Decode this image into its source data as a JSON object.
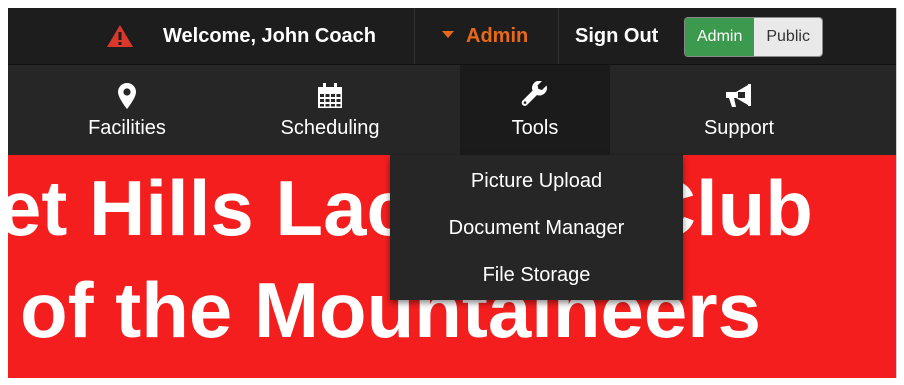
{
  "topbar": {
    "welcome_text": "Welcome, John Coach",
    "admin_menu_label": "Admin",
    "signout_label": "Sign Out",
    "view_toggle": {
      "active_label": "Admin",
      "inactive_label": "Public"
    }
  },
  "nav": {
    "items": [
      {
        "label": "Facilities",
        "icon": "map-marker-icon"
      },
      {
        "label": "Scheduling",
        "icon": "calendar-icon"
      },
      {
        "label": "Tools",
        "icon": "wrench-icon"
      },
      {
        "label": "Support",
        "icon": "megaphone-icon"
      }
    ]
  },
  "tools_dropdown": {
    "items": [
      "Picture Upload",
      "Document Manager",
      "File Storage"
    ]
  },
  "banner": {
    "line1": "et Hills Lacrosse Club",
    "line2": "of the Mountaineers"
  },
  "colors": {
    "topbar_bg": "#1d1d1d",
    "nav_bg": "#262626",
    "admin_accent": "#e8691a",
    "warning_red": "#d9382a",
    "toggle_active": "#3c9a4e",
    "banner_red": "#f41e1e"
  }
}
